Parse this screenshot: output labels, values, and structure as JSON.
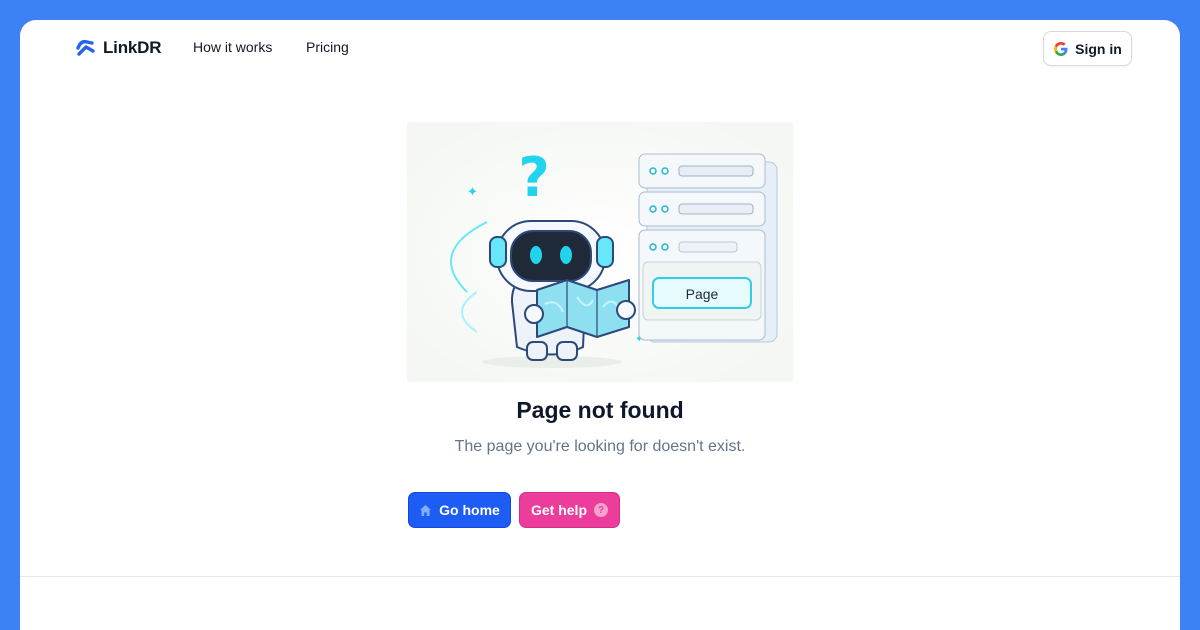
{
  "brand": {
    "name": "LinkDR",
    "icon": "linkdr-logo-icon",
    "color": "#2563eb"
  },
  "nav": {
    "links": [
      {
        "label": "How it works"
      },
      {
        "label": "Pricing"
      }
    ],
    "signin": {
      "label": "Sign in",
      "icon": "google-icon"
    }
  },
  "illustration": {
    "page_label": "Page",
    "question_mark": "?"
  },
  "main": {
    "title": "Page not found",
    "subtitle": "The page you're looking for doesn't exist.",
    "buttons": {
      "home": {
        "label": "Go home",
        "icon": "home-icon",
        "color": "#1d5cf5"
      },
      "help": {
        "label": "Get help",
        "icon": "question-circle-icon",
        "color": "#ec3d9c"
      }
    }
  },
  "colors": {
    "background": "#3d82f5",
    "accent_cyan": "#22d3ee"
  }
}
